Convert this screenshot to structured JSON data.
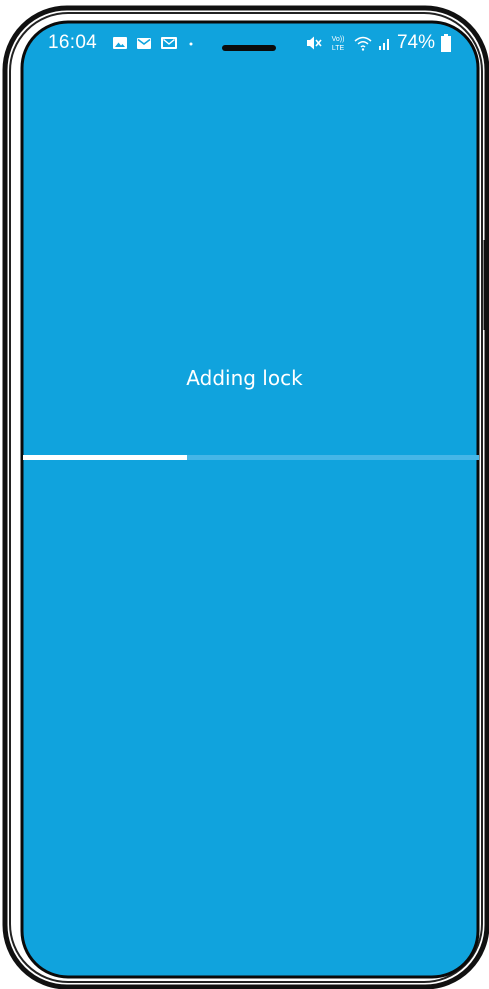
{
  "status_bar": {
    "time": "16:04",
    "notification_icons": [
      "image-icon",
      "mail-icon",
      "mail-outline-icon",
      "dot-icon"
    ],
    "system_icons": [
      "mute-icon",
      "volte-icon",
      "wifi-icon",
      "signal-icon",
      "battery-icon"
    ],
    "volte_label_top": "Vo))",
    "volte_label_bottom": "LTE",
    "battery": "74%"
  },
  "screen": {
    "background_color": "#10a3dd",
    "title": "Adding lock",
    "progress": {
      "fraction": 0.36,
      "fill_color": "#ffffff",
      "track_color": "#46b6e7"
    }
  }
}
